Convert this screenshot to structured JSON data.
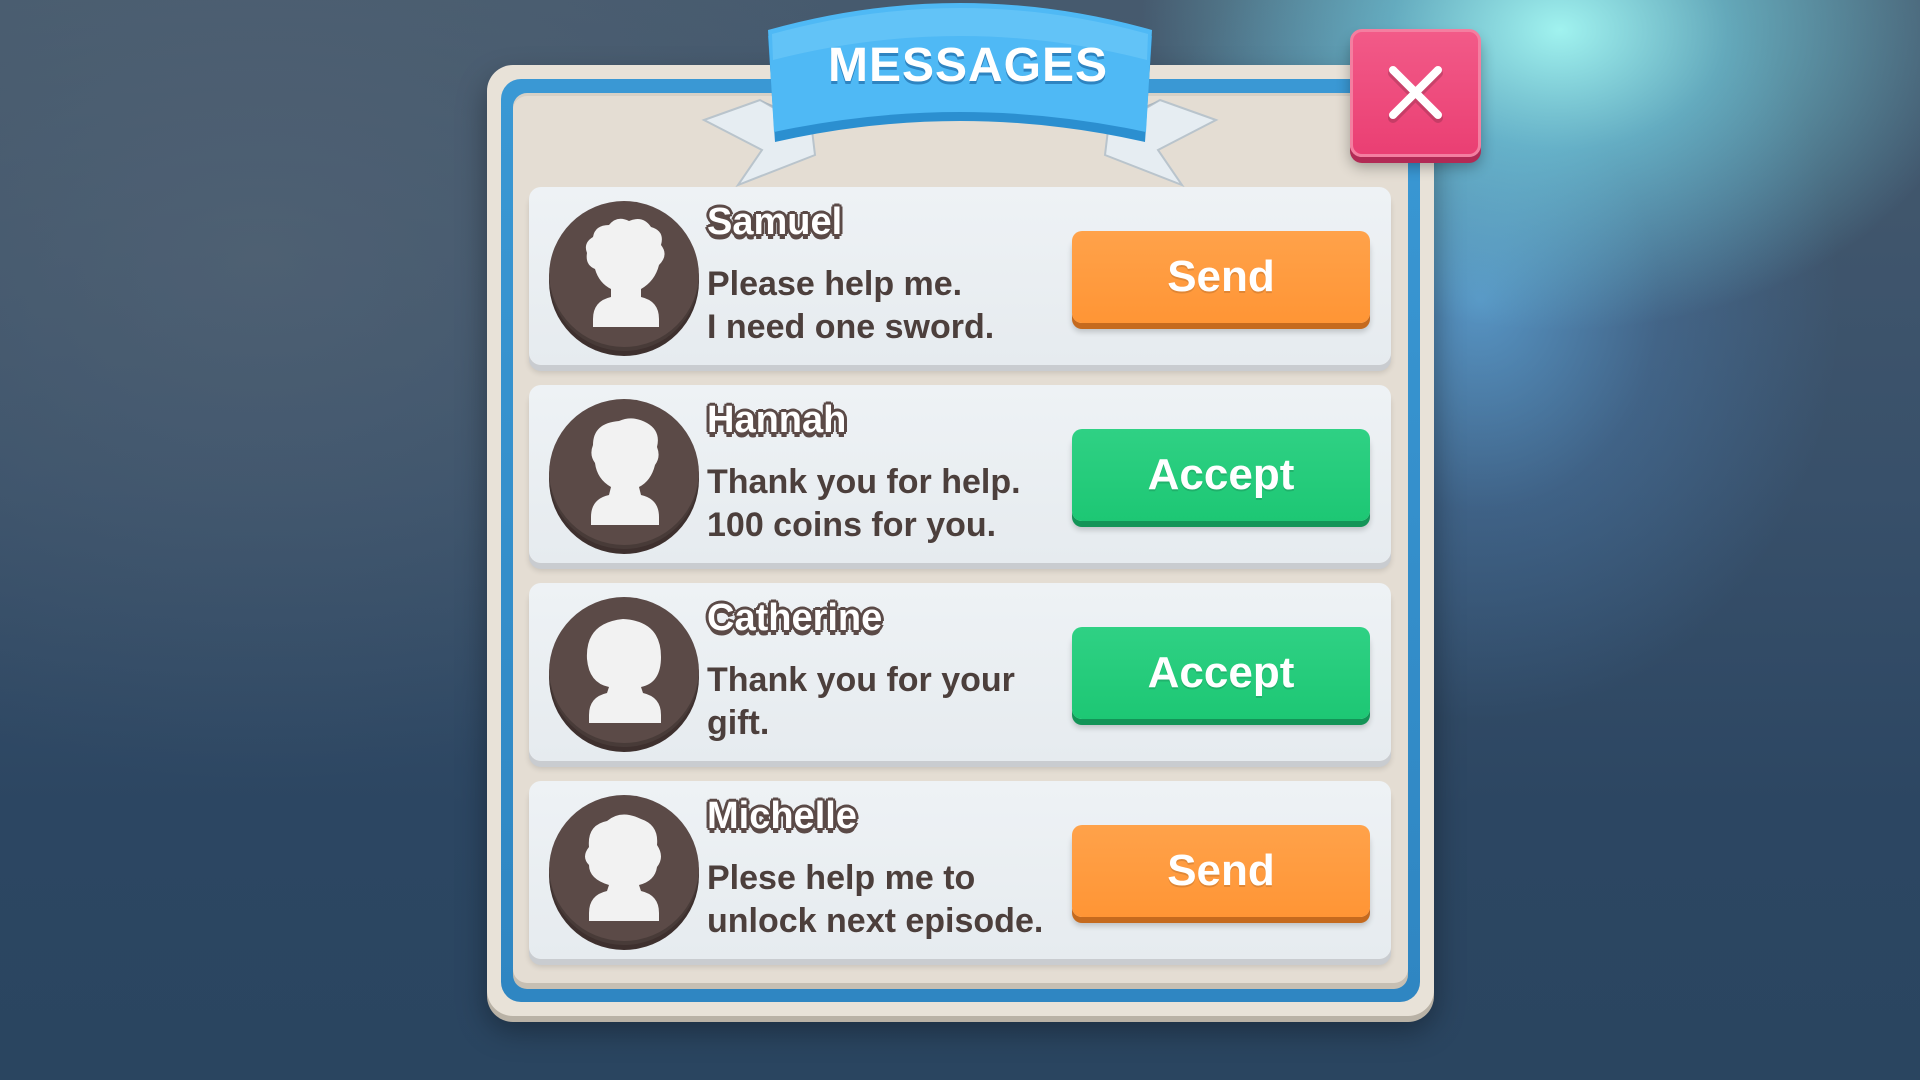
{
  "dialog": {
    "title": "MESSAGES",
    "close_icon": "close-x-icon",
    "colors": {
      "frame_blue": "#3a98d4",
      "ribbon_blue": "#4db8f5",
      "close_pink": "#ec4577",
      "send_orange": "#ff9a3e",
      "accept_green": "#20ca78",
      "avatar_brown": "#5b4a47"
    }
  },
  "messages": [
    {
      "name": "Samuel",
      "avatar_icon": "male-curly-hair-avatar-icon",
      "text": "Please help me.\nI need one sword.",
      "action": "Send"
    },
    {
      "name": "Hannah",
      "avatar_icon": "short-hair-avatar-icon",
      "text": "Thank you for help.\n100 coins for you.",
      "action": "Accept"
    },
    {
      "name": "Catherine",
      "avatar_icon": "bob-hair-avatar-icon",
      "text": "Thank you for your\ngift.",
      "action": "Accept"
    },
    {
      "name": "Michelle",
      "avatar_icon": "wavy-hair-avatar-icon",
      "text": "Plese help me to\nunlock next episode.",
      "action": "Send"
    }
  ]
}
